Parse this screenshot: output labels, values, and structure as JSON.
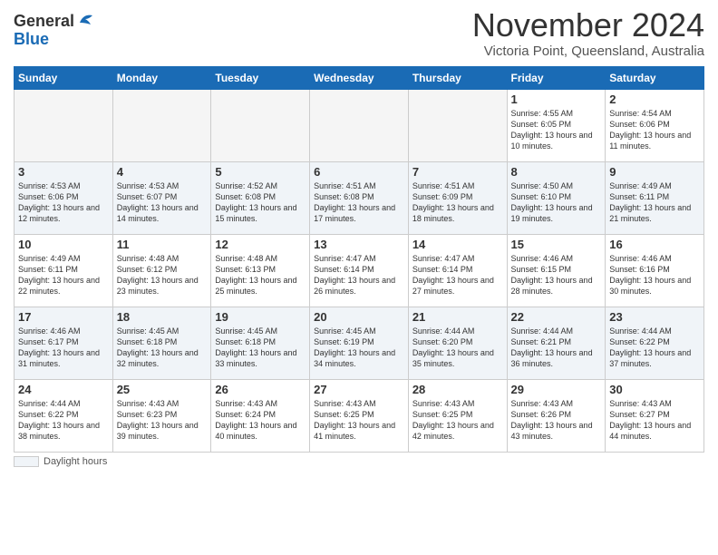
{
  "header": {
    "logo_general": "General",
    "logo_blue": "Blue",
    "month_title": "November 2024",
    "location": "Victoria Point, Queensland, Australia"
  },
  "days_of_week": [
    "Sunday",
    "Monday",
    "Tuesday",
    "Wednesday",
    "Thursday",
    "Friday",
    "Saturday"
  ],
  "weeks": [
    [
      {
        "num": "",
        "empty": true
      },
      {
        "num": "",
        "empty": true
      },
      {
        "num": "",
        "empty": true
      },
      {
        "num": "",
        "empty": true
      },
      {
        "num": "",
        "empty": true
      },
      {
        "num": "1",
        "sunrise": "Sunrise: 4:55 AM",
        "sunset": "Sunset: 6:05 PM",
        "daylight": "Daylight: 13 hours and 10 minutes."
      },
      {
        "num": "2",
        "sunrise": "Sunrise: 4:54 AM",
        "sunset": "Sunset: 6:06 PM",
        "daylight": "Daylight: 13 hours and 11 minutes."
      }
    ],
    [
      {
        "num": "3",
        "sunrise": "Sunrise: 4:53 AM",
        "sunset": "Sunset: 6:06 PM",
        "daylight": "Daylight: 13 hours and 12 minutes."
      },
      {
        "num": "4",
        "sunrise": "Sunrise: 4:53 AM",
        "sunset": "Sunset: 6:07 PM",
        "daylight": "Daylight: 13 hours and 14 minutes."
      },
      {
        "num": "5",
        "sunrise": "Sunrise: 4:52 AM",
        "sunset": "Sunset: 6:08 PM",
        "daylight": "Daylight: 13 hours and 15 minutes."
      },
      {
        "num": "6",
        "sunrise": "Sunrise: 4:51 AM",
        "sunset": "Sunset: 6:08 PM",
        "daylight": "Daylight: 13 hours and 17 minutes."
      },
      {
        "num": "7",
        "sunrise": "Sunrise: 4:51 AM",
        "sunset": "Sunset: 6:09 PM",
        "daylight": "Daylight: 13 hours and 18 minutes."
      },
      {
        "num": "8",
        "sunrise": "Sunrise: 4:50 AM",
        "sunset": "Sunset: 6:10 PM",
        "daylight": "Daylight: 13 hours and 19 minutes."
      },
      {
        "num": "9",
        "sunrise": "Sunrise: 4:49 AM",
        "sunset": "Sunset: 6:11 PM",
        "daylight": "Daylight: 13 hours and 21 minutes."
      }
    ],
    [
      {
        "num": "10",
        "sunrise": "Sunrise: 4:49 AM",
        "sunset": "Sunset: 6:11 PM",
        "daylight": "Daylight: 13 hours and 22 minutes."
      },
      {
        "num": "11",
        "sunrise": "Sunrise: 4:48 AM",
        "sunset": "Sunset: 6:12 PM",
        "daylight": "Daylight: 13 hours and 23 minutes."
      },
      {
        "num": "12",
        "sunrise": "Sunrise: 4:48 AM",
        "sunset": "Sunset: 6:13 PM",
        "daylight": "Daylight: 13 hours and 25 minutes."
      },
      {
        "num": "13",
        "sunrise": "Sunrise: 4:47 AM",
        "sunset": "Sunset: 6:14 PM",
        "daylight": "Daylight: 13 hours and 26 minutes."
      },
      {
        "num": "14",
        "sunrise": "Sunrise: 4:47 AM",
        "sunset": "Sunset: 6:14 PM",
        "daylight": "Daylight: 13 hours and 27 minutes."
      },
      {
        "num": "15",
        "sunrise": "Sunrise: 4:46 AM",
        "sunset": "Sunset: 6:15 PM",
        "daylight": "Daylight: 13 hours and 28 minutes."
      },
      {
        "num": "16",
        "sunrise": "Sunrise: 4:46 AM",
        "sunset": "Sunset: 6:16 PM",
        "daylight": "Daylight: 13 hours and 30 minutes."
      }
    ],
    [
      {
        "num": "17",
        "sunrise": "Sunrise: 4:46 AM",
        "sunset": "Sunset: 6:17 PM",
        "daylight": "Daylight: 13 hours and 31 minutes."
      },
      {
        "num": "18",
        "sunrise": "Sunrise: 4:45 AM",
        "sunset": "Sunset: 6:18 PM",
        "daylight": "Daylight: 13 hours and 32 minutes."
      },
      {
        "num": "19",
        "sunrise": "Sunrise: 4:45 AM",
        "sunset": "Sunset: 6:18 PM",
        "daylight": "Daylight: 13 hours and 33 minutes."
      },
      {
        "num": "20",
        "sunrise": "Sunrise: 4:45 AM",
        "sunset": "Sunset: 6:19 PM",
        "daylight": "Daylight: 13 hours and 34 minutes."
      },
      {
        "num": "21",
        "sunrise": "Sunrise: 4:44 AM",
        "sunset": "Sunset: 6:20 PM",
        "daylight": "Daylight: 13 hours and 35 minutes."
      },
      {
        "num": "22",
        "sunrise": "Sunrise: 4:44 AM",
        "sunset": "Sunset: 6:21 PM",
        "daylight": "Daylight: 13 hours and 36 minutes."
      },
      {
        "num": "23",
        "sunrise": "Sunrise: 4:44 AM",
        "sunset": "Sunset: 6:22 PM",
        "daylight": "Daylight: 13 hours and 37 minutes."
      }
    ],
    [
      {
        "num": "24",
        "sunrise": "Sunrise: 4:44 AM",
        "sunset": "Sunset: 6:22 PM",
        "daylight": "Daylight: 13 hours and 38 minutes."
      },
      {
        "num": "25",
        "sunrise": "Sunrise: 4:43 AM",
        "sunset": "Sunset: 6:23 PM",
        "daylight": "Daylight: 13 hours and 39 minutes."
      },
      {
        "num": "26",
        "sunrise": "Sunrise: 4:43 AM",
        "sunset": "Sunset: 6:24 PM",
        "daylight": "Daylight: 13 hours and 40 minutes."
      },
      {
        "num": "27",
        "sunrise": "Sunrise: 4:43 AM",
        "sunset": "Sunset: 6:25 PM",
        "daylight": "Daylight: 13 hours and 41 minutes."
      },
      {
        "num": "28",
        "sunrise": "Sunrise: 4:43 AM",
        "sunset": "Sunset: 6:25 PM",
        "daylight": "Daylight: 13 hours and 42 minutes."
      },
      {
        "num": "29",
        "sunrise": "Sunrise: 4:43 AM",
        "sunset": "Sunset: 6:26 PM",
        "daylight": "Daylight: 13 hours and 43 minutes."
      },
      {
        "num": "30",
        "sunrise": "Sunrise: 4:43 AM",
        "sunset": "Sunset: 6:27 PM",
        "daylight": "Daylight: 13 hours and 44 minutes."
      }
    ]
  ],
  "footer": {
    "daylight_label": "Daylight hours"
  }
}
